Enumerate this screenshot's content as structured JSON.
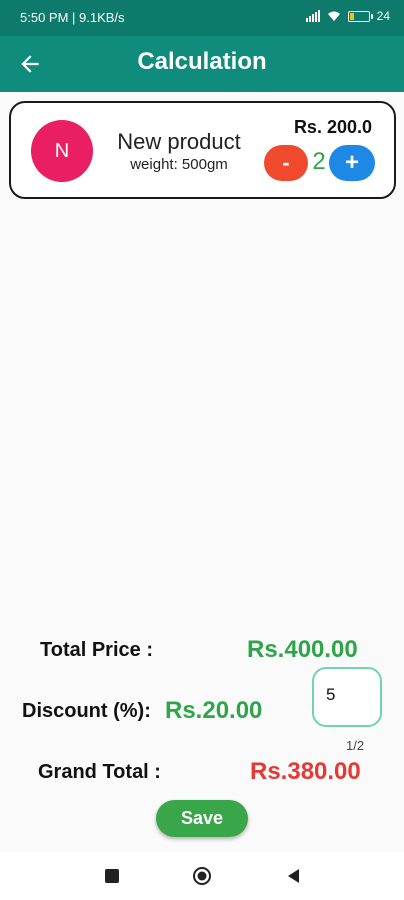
{
  "status_bar": {
    "time_speed": "5:50 PM | 9.1KB/s",
    "battery_level": "24"
  },
  "app_bar": {
    "title": "Calculation",
    "back_icon": "arrow-left-icon"
  },
  "product": {
    "avatar_letter": "N",
    "avatar_color": "#e91e63",
    "name": "New product",
    "weight": "weight: 500gm",
    "price": "Rs. 200.0",
    "decrement_label": "-",
    "quantity": "2",
    "increment_label": "+"
  },
  "summary": {
    "total_price_label": "Total Price :",
    "total_price_value": "Rs.400.00",
    "discount_label": "Discount (%):",
    "discount_value": "Rs.20.00",
    "discount_input_value": "5",
    "discount_counter": "1/2",
    "grand_total_label": "Grand Total :",
    "grand_total_value": "Rs.380.00"
  },
  "actions": {
    "save_label": "Save"
  },
  "colors": {
    "app_bar": "#0f8c7b",
    "status_bar": "#0d7a6b",
    "accent_green": "#2fa54a",
    "accent_red": "#e53935",
    "plus_button": "#1e88e5",
    "minus_button": "#f04a2e"
  },
  "nav_bar": {
    "icons": [
      "recent-apps-icon",
      "home-icon",
      "back-triangle-icon"
    ]
  }
}
